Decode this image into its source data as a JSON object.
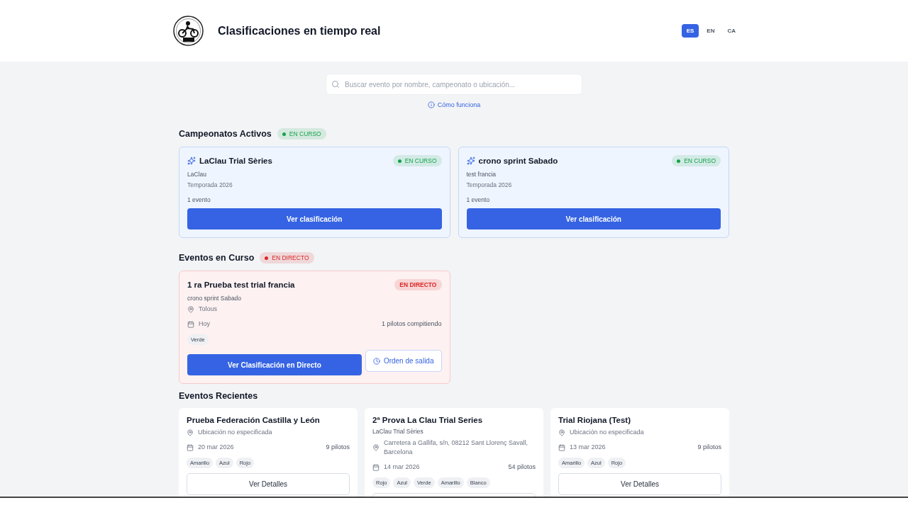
{
  "header": {
    "title": "Clasificaciones en tiempo real",
    "languages": [
      {
        "label": "ES",
        "selected": true
      },
      {
        "label": "EN",
        "selected": false
      },
      {
        "label": "CA",
        "selected": false
      }
    ]
  },
  "search": {
    "placeholder": "Buscar evento por nombre, campeonato o ubicación..."
  },
  "help_link": "Cómo funciona",
  "championships": {
    "title": "Campeonatos Activos",
    "badge": {
      "label": "EN CURSO",
      "color": "#16a34a",
      "dot": true
    },
    "items": [
      {
        "name": "LaClau Trial Sèries",
        "organizer": "LaClau",
        "season": "Temporada 2026",
        "events": "1 evento",
        "status": {
          "label": "EN CURSO",
          "color": "#16a34a",
          "dot": true
        },
        "button": "Ver clasificación"
      },
      {
        "name": "crono sprint Sabado",
        "organizer": "test francia",
        "season": "Temporada 2026",
        "events": "1 evento",
        "status": {
          "label": "EN CURSO",
          "color": "#16a34a",
          "dot": true
        },
        "button": "Ver clasificación"
      }
    ]
  },
  "live": {
    "title": "Eventos en Curso",
    "badge": {
      "label": "EN DIRECTO",
      "color": "#dc2626",
      "dot": true
    },
    "items": [
      {
        "name": "1 ra Prueba test trial francia",
        "championship": "crono sprint Sabado",
        "location": "Tolous",
        "date": "Hoy",
        "pilots": "1 pilotos compitiendo",
        "categories": [
          "Verde"
        ],
        "status": {
          "label": "EN DIRECTO",
          "color": "#dc2626",
          "dot": false
        },
        "primary_button": "Ver Clasificación en Directo",
        "secondary_button": "Orden de salida"
      }
    ]
  },
  "recent": {
    "title": "Eventos Recientes",
    "items": [
      {
        "name": "Prueba Federación Castilla y León",
        "location": "Ubicación no especificada",
        "date": "20 mar 2026",
        "pilots": "9 pilotos",
        "categories": [
          "Amarillo",
          "Azul",
          "Rojo"
        ],
        "button": "Ver Detalles"
      },
      {
        "name": "2ª Prova La Clau Trial Series",
        "championship": "LaClau Trial Sèries",
        "location": "Carretera a Gallifa, s/n, 08212 Sant Llorenç Savall, Barcelona",
        "date": "14 mar 2026",
        "pilots": "54 pilotos",
        "categories": [
          "Rojo",
          "Azul",
          "Verde",
          "Amarillo",
          "Blanco"
        ]
      },
      {
        "name": "Trial Riojana (Test)",
        "location": "Ubicación no especificada",
        "date": "13 mar 2026",
        "pilots": "9 pilotos",
        "categories": [
          "Amarillo",
          "Azul",
          "Rojo"
        ],
        "button": "Ver Detalles"
      }
    ]
  }
}
